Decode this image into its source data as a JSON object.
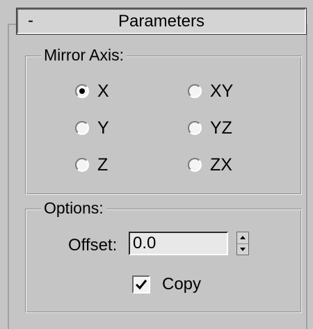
{
  "rollout": {
    "toggle": "-",
    "title": "Parameters"
  },
  "mirror_axis": {
    "label": "Mirror Axis:",
    "options": [
      "X",
      "Y",
      "Z",
      "XY",
      "YZ",
      "ZX"
    ],
    "selected": "X"
  },
  "options": {
    "label": "Options:",
    "offset_label": "Offset:",
    "offset_value": "0.0",
    "copy_label": "Copy",
    "copy_checked": true
  }
}
